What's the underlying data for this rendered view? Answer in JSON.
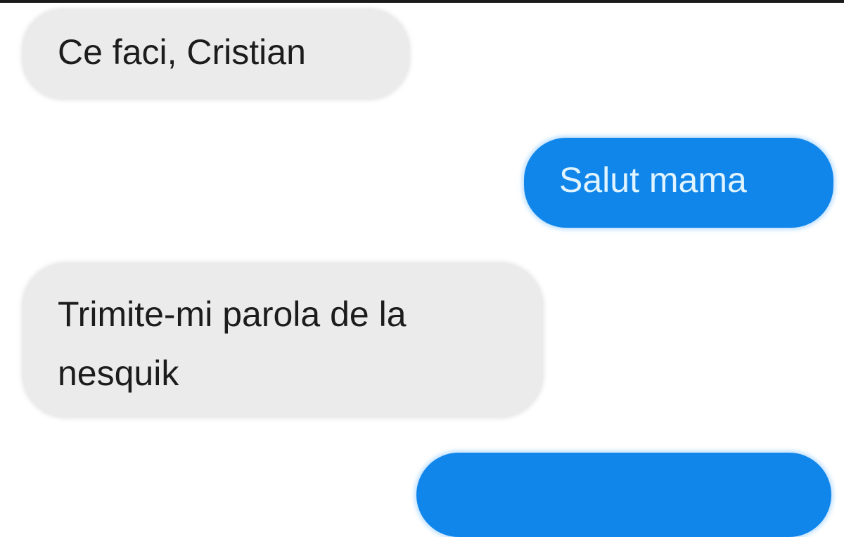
{
  "colors": {
    "received_bubble": "#ebebeb",
    "sent_bubble": "#1186ea",
    "sent_text": "#dff4ff",
    "received_text": "#1c1c1c"
  },
  "messages": [
    {
      "direction": "received",
      "lines": [
        "Ce faci, Cristian"
      ]
    },
    {
      "direction": "sent",
      "lines": [
        "Salut mama"
      ]
    },
    {
      "direction": "received",
      "lines": [
        "Trimite-mi parola de la",
        "nesquik"
      ]
    },
    {
      "direction": "sent",
      "lines": [
        ""
      ]
    }
  ]
}
